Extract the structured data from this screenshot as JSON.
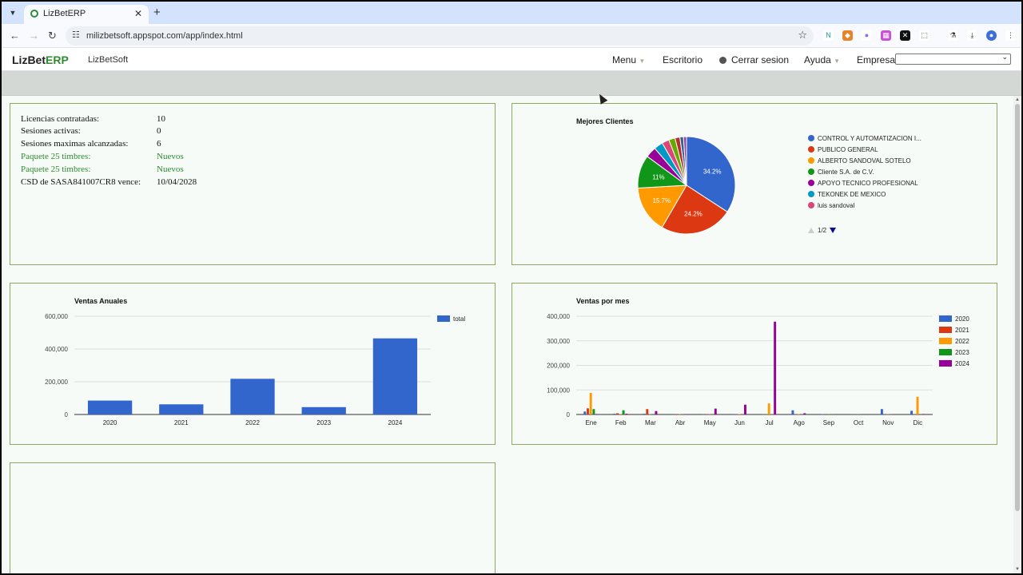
{
  "browser": {
    "tab_title": "LizBetERP",
    "url": "milizbetsoft.appspot.com/app/index.html"
  },
  "app": {
    "brand_a": "LizBet",
    "brand_b": "ERP",
    "company": "LizBetSoft",
    "menu": "Menu",
    "escritorio": "Escritorio",
    "cerrar": "Cerrar sesion",
    "ayuda": "Ayuda",
    "empresa_label": "Empresa:",
    "empresa_value": ""
  },
  "info": [
    {
      "label": "Licencias contratadas:",
      "value": "10",
      "green": false
    },
    {
      "label": "Sesiones activas:",
      "value": "0",
      "green": false
    },
    {
      "label": "Sesiones maximas alcanzadas:",
      "value": "6",
      "green": false
    },
    {
      "label": "Paquete 25 timbres:",
      "value": "Nuevos",
      "green": true
    },
    {
      "label": "Paquete 25 timbres:",
      "value": "Nuevos",
      "green": true
    },
    {
      "label": "CSD de SASA841007CR8 vence:",
      "value": "10/04/2028",
      "green": false
    }
  ],
  "colors": {
    "blue": "#3366cc",
    "red": "#dc3912",
    "orange": "#ff9900",
    "green": "#109618",
    "purple": "#990099",
    "teal": "#0099c6",
    "pink": "#dd4477",
    "olive": "#66aa00",
    "maroon": "#b82e2e",
    "navy": "#316395"
  },
  "chart_data": [
    {
      "type": "pie",
      "title": "Mejores Clientes",
      "legend": [
        "CONTROL Y AUTOMATIZACION I...",
        "PUBLICO GENERAL",
        "ALBERTO SANDOVAL SOTELO",
        "Cliente S.A. de C.V.",
        "APOYO TECNICO PROFESIONAL",
        "TEKONEK DE MEXICO",
        "luis sandoval"
      ],
      "legend_page": "1/2",
      "slices": [
        34.2,
        24.2,
        15.7,
        11,
        3.6,
        3.0,
        2.4,
        2.1,
        1.6,
        1.2,
        1.0
      ],
      "slice_labels": [
        "34.2%",
        "24.2%",
        "15.7%",
        "11%"
      ]
    },
    {
      "type": "bar",
      "title": "Ventas Anuales",
      "categories": [
        "2020",
        "2021",
        "2022",
        "2023",
        "2024"
      ],
      "series": [
        {
          "name": "total",
          "values": [
            85000,
            62000,
            218000,
            45000,
            465000
          ]
        }
      ],
      "yticks": [
        "0",
        "200,000",
        "400,000",
        "600,000"
      ],
      "ylim": [
        0,
        600000
      ],
      "legend_position": "right"
    },
    {
      "type": "bar",
      "title": "Ventas por mes",
      "categories": [
        "Ene",
        "Feb",
        "Mar",
        "Abr",
        "May",
        "Jun",
        "Jul",
        "Ago",
        "Sep",
        "Oct",
        "Nov",
        "Dic"
      ],
      "series": [
        {
          "name": "2020",
          "values": [
            12000,
            3000,
            3000,
            2000,
            1000,
            2000,
            1000,
            17000,
            1000,
            500,
            22000,
            15000
          ]
        },
        {
          "name": "2021",
          "values": [
            25000,
            5000,
            22000,
            2000,
            1000,
            1000,
            1000,
            1000,
            500,
            500,
            1000,
            1000
          ]
        },
        {
          "name": "2022",
          "values": [
            88000,
            2000,
            1000,
            1000,
            1000,
            2000,
            45000,
            2000,
            500,
            500,
            1000,
            72000
          ]
        },
        {
          "name": "2023",
          "values": [
            22000,
            17000,
            2000,
            1000,
            1000,
            1000,
            1000,
            1000,
            500,
            500,
            1000,
            1000
          ]
        },
        {
          "name": "2024",
          "values": [
            2000,
            3000,
            14000,
            1000,
            24000,
            40000,
            378000,
            5000,
            500,
            500,
            1000,
            2000
          ]
        }
      ],
      "yticks": [
        "0",
        "100,000",
        "200,000",
        "300,000",
        "400,000"
      ],
      "ylim": [
        0,
        400000
      ],
      "legend_position": "right"
    }
  ]
}
